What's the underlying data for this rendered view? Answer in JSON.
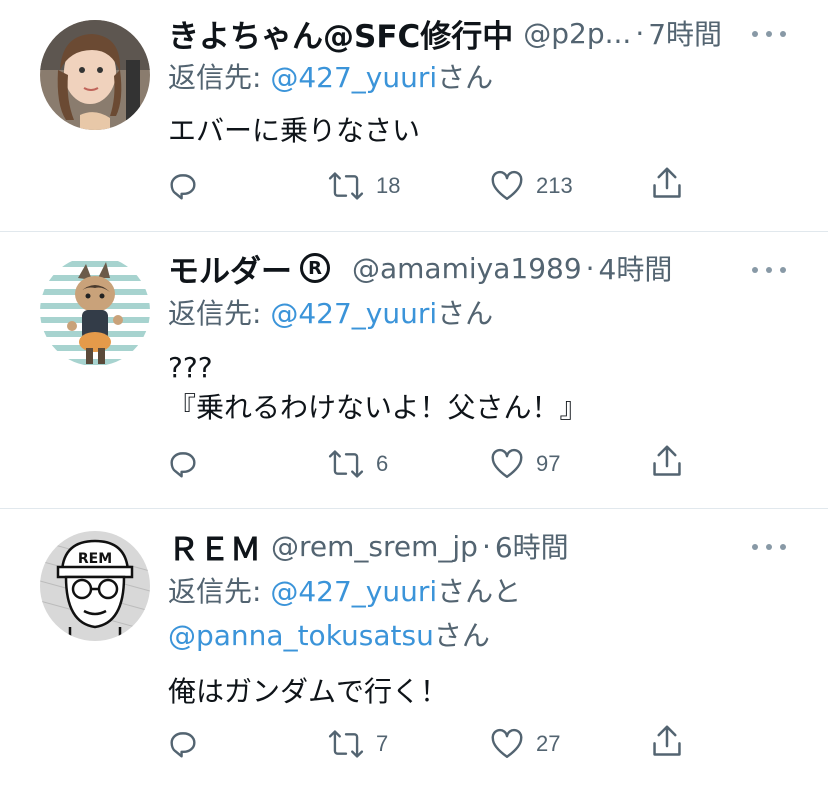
{
  "tweets": [
    {
      "name": "きよちゃん@SFC修行中",
      "handle": "@p2p...",
      "dot": "·",
      "time": "7時間",
      "reply_prefix": "返信先: ",
      "reply_mention": "@427_yuuri",
      "reply_suffix": "さん",
      "text_lines": [
        "エバーに乗りなさい"
      ],
      "retweets": "18",
      "likes": "213"
    },
    {
      "name": "モルダー",
      "verified_symbol": "R",
      "handle": "@amamiya1989",
      "dot": "·",
      "time": "4時間",
      "reply_prefix": "返信先: ",
      "reply_mention": "@427_yuuri",
      "reply_suffix": "さん",
      "text_lines": [
        "???",
        "『乗れるわけないよ！父さん！』"
      ],
      "retweets": "6",
      "likes": "97"
    },
    {
      "name": "ＲＥＭ",
      "handle": "@rem_srem_jp",
      "dot": "·",
      "time": "6時間",
      "reply_prefix": "返信先: ",
      "reply_mention": "@427_yuuri",
      "reply_suffix": "さんと",
      "reply_mention2": "@panna_tokusatsu",
      "reply_suffix2": "さん",
      "text_lines": [
        "俺はガンダムで行く！"
      ],
      "retweets": "7",
      "likes": "27"
    }
  ],
  "colors": {
    "mention": "#3b94d9",
    "secondary_text": "#536471",
    "icon": "#536471",
    "divider": "#e1e8ed"
  },
  "icons": [
    "reply-icon",
    "retweet-icon",
    "like-icon",
    "share-icon",
    "more-icon"
  ]
}
